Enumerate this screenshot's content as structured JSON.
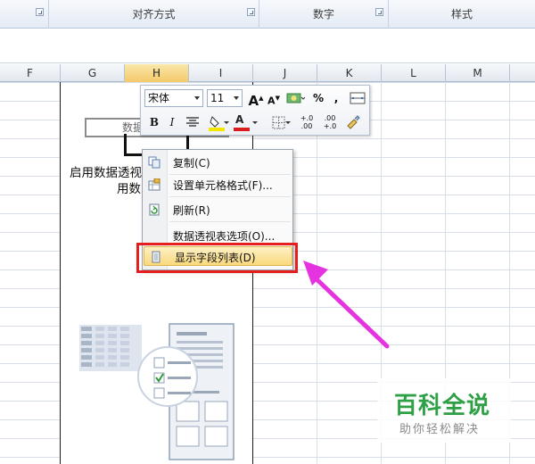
{
  "ribbon": {
    "groups": [
      {
        "label": ""
      },
      {
        "label": "对齐方式"
      },
      {
        "label": "数字"
      },
      {
        "label": "样式"
      }
    ]
  },
  "columns": [
    "F",
    "G",
    "H",
    "I",
    "J",
    "K",
    "L",
    "M"
  ],
  "active_column": "H",
  "pivot": {
    "field_text": "数据",
    "message_line1": "启用数据透视",
    "message_line2": "用数"
  },
  "mini_toolbar": {
    "font_name": "宋体",
    "font_size": "11",
    "bold": "B",
    "italic": "I",
    "font_color_letter": "A",
    "percent": "%",
    "comma": ",",
    "inc_decimal": "+.0 .00",
    "dec_decimal": ".00 +.0",
    "font_color": "#d91c1c",
    "fill_color": "#f5e600"
  },
  "context_menu": {
    "items": [
      {
        "label": "复制(C)",
        "icon": "copy-icon"
      },
      {
        "label": "设置单元格格式(F)...",
        "icon": "format-cells-icon"
      },
      {
        "label": "刷新(R)",
        "icon": "refresh-icon"
      },
      {
        "label": "数据透视表选项(O)...",
        "icon": ""
      },
      {
        "label": "显示字段列表(D)",
        "icon": "field-list-icon",
        "highlighted": true
      }
    ]
  },
  "annotation": {
    "highlight_color": "#e51e1e",
    "arrow_color": "#e633e0"
  },
  "watermark": {
    "title": "百科全说",
    "subtitle": "助你轻松解决"
  }
}
